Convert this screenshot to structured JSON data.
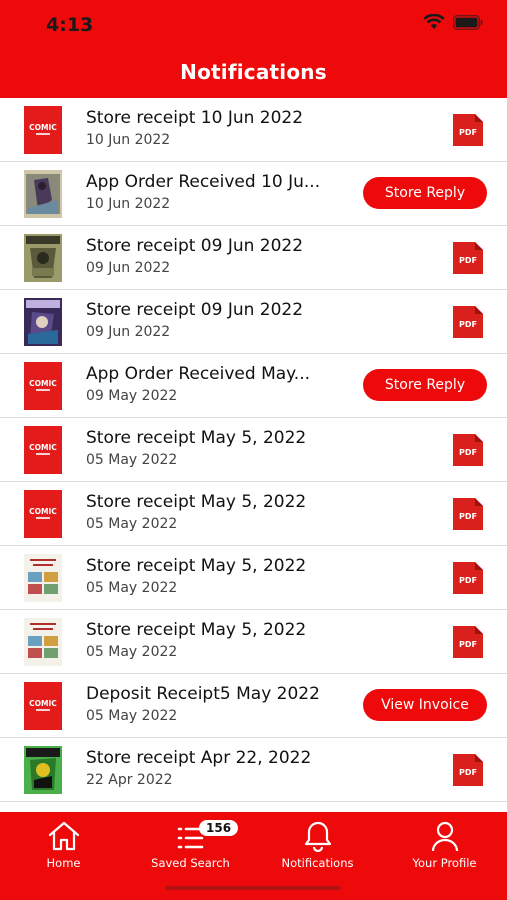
{
  "status": {
    "time": "4:13"
  },
  "header": {
    "title": "Notifications"
  },
  "rows": [
    {
      "title": "Store receipt 10 Jun 2022",
      "date": "10 Jun 2022",
      "action": "pdf",
      "thumb": "comic-logo"
    },
    {
      "title": "App Order Received 10 Ju...",
      "date": "10 Jun 2022",
      "action": "button",
      "button_label": "Store Reply",
      "thumb": "comic-cover-dark"
    },
    {
      "title": "Store receipt 09 Jun 2022",
      "date": "09 Jun 2022",
      "action": "pdf",
      "thumb": "comic-cover-khaki"
    },
    {
      "title": "Store receipt 09 Jun 2022",
      "date": "09 Jun 2022",
      "action": "pdf",
      "thumb": "comic-cover-purple"
    },
    {
      "title": "App Order Received May...",
      "date": "09 May 2022",
      "action": "button",
      "button_label": "Store Reply",
      "thumb": "comic-logo"
    },
    {
      "title": "Store receipt May 5, 2022",
      "date": "05 May 2022",
      "action": "pdf",
      "thumb": "comic-logo"
    },
    {
      "title": "Store receipt May 5, 2022",
      "date": "05 May 2022",
      "action": "pdf",
      "thumb": "comic-logo"
    },
    {
      "title": "Store receipt May 5, 2022",
      "date": "05 May 2022",
      "action": "pdf",
      "thumb": "book-index"
    },
    {
      "title": "Store receipt May 5, 2022",
      "date": "05 May 2022",
      "action": "pdf",
      "thumb": "book-index"
    },
    {
      "title": "Deposit Receipt5 May 2022",
      "date": "05 May 2022",
      "action": "button",
      "button_label": "View Invoice",
      "thumb": "comic-logo"
    },
    {
      "title": "Store receipt Apr 22, 2022",
      "date": "22 Apr 2022",
      "action": "pdf",
      "thumb": "comic-cover-green"
    }
  ],
  "icons": {
    "pdf_label": "PDF",
    "logo_text": "COMIC"
  },
  "tabbar": {
    "home": "Home",
    "saved_search": "Saved Search",
    "saved_search_badge": "156",
    "notifications": "Notifications",
    "profile": "Your Profile"
  },
  "colors": {
    "brand_red": "#ee0a0a",
    "pdf_red": "#d9201c"
  }
}
